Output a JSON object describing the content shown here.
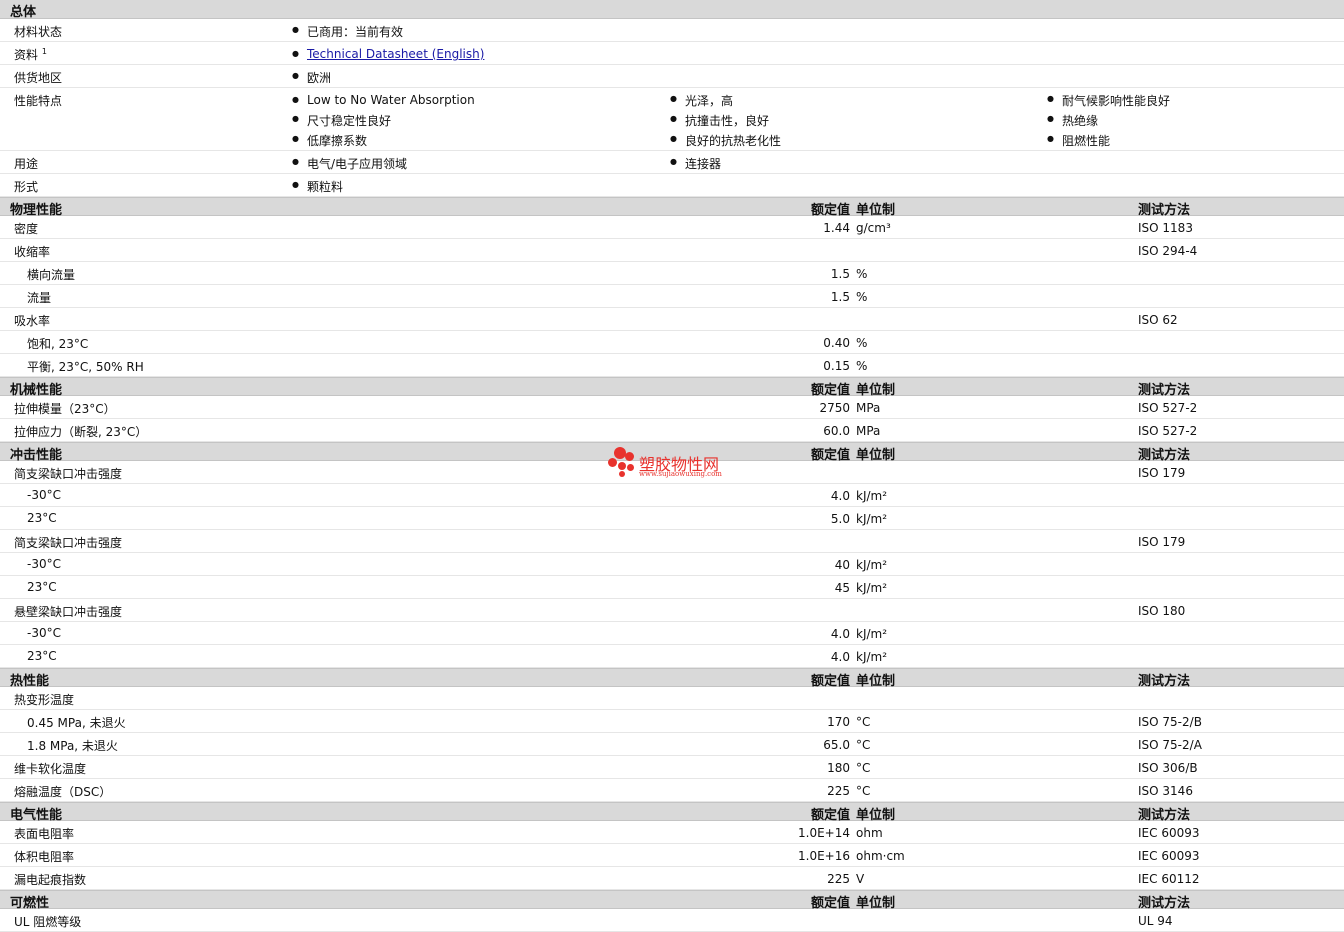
{
  "general": {
    "title": "总体",
    "status_label": "材料状态",
    "status_value": "已商用：当前有效",
    "doc_label": "资料",
    "doc_sup": "1",
    "doc_link": "Technical Datasheet (English)",
    "region_label": "供货地区",
    "region_value": "欧洲",
    "features_label": "性能特点",
    "features": [
      "Low to No Water Absorption",
      "光泽，高",
      "耐气候影响性能良好",
      "尺寸稳定性良好",
      "抗撞击性，良好",
      "热绝缘",
      "低摩擦系数",
      "良好的抗热老化性",
      "阻燃性能"
    ],
    "uses_label": "用途",
    "uses": [
      "电气/电子应用领域",
      "连接器"
    ],
    "form_label": "形式",
    "form_value": "颗粒料"
  },
  "headers": {
    "nominal": "额定值",
    "unit": "单位制",
    "test": "测试方法"
  },
  "physical": {
    "title": "物理性能",
    "rows": [
      {
        "label": "密度",
        "value": "1.44",
        "unit": "g/cm³",
        "test": "ISO 1183"
      },
      {
        "label": "收缩率",
        "value": "",
        "unit": "",
        "test": "ISO 294-4"
      },
      {
        "label": "横向流量",
        "value": "1.5",
        "unit": "%",
        "test": ""
      },
      {
        "label": "流量",
        "value": "1.5",
        "unit": "%",
        "test": ""
      },
      {
        "label": "吸水率",
        "value": "",
        "unit": "",
        "test": "ISO 62"
      },
      {
        "label": "饱和, 23°C",
        "value": "0.40",
        "unit": "%",
        "test": ""
      },
      {
        "label": "平衡, 23°C, 50% RH",
        "value": "0.15",
        "unit": "%",
        "test": ""
      }
    ]
  },
  "mechanical": {
    "title": "机械性能",
    "rows": [
      {
        "label": "拉伸模量（23°C）",
        "value": "2750",
        "unit": "MPa",
        "test": "ISO 527-2"
      },
      {
        "label": "拉伸应力（断裂, 23°C）",
        "value": "60.0",
        "unit": "MPa",
        "test": "ISO 527-2"
      }
    ]
  },
  "impact": {
    "title": "冲击性能",
    "rows": [
      {
        "label": "简支梁缺口冲击强度",
        "value": "",
        "unit": "",
        "test": "ISO 179"
      },
      {
        "label": "-30°C",
        "value": "4.0",
        "unit": "kJ/m²",
        "test": ""
      },
      {
        "label": "23°C",
        "value": "5.0",
        "unit": "kJ/m²",
        "test": ""
      },
      {
        "label": "简支梁缺口冲击强度",
        "value": "",
        "unit": "",
        "test": "ISO 179"
      },
      {
        "label": "-30°C",
        "value": "40",
        "unit": "kJ/m²",
        "test": ""
      },
      {
        "label": "23°C",
        "value": "45",
        "unit": "kJ/m²",
        "test": ""
      },
      {
        "label": "悬壁梁缺口冲击强度",
        "value": "",
        "unit": "",
        "test": "ISO 180"
      },
      {
        "label": "-30°C",
        "value": "4.0",
        "unit": "kJ/m²",
        "test": ""
      },
      {
        "label": "23°C",
        "value": "4.0",
        "unit": "kJ/m²",
        "test": ""
      }
    ]
  },
  "thermal": {
    "title": "热性能",
    "rows": [
      {
        "label": "热变形温度",
        "value": "",
        "unit": "",
        "test": ""
      },
      {
        "label": "0.45 MPa, 未退火",
        "value": "170",
        "unit": "°C",
        "test": "ISO 75-2/B"
      },
      {
        "label": "1.8 MPa, 未退火",
        "value": "65.0",
        "unit": "°C",
        "test": "ISO 75-2/A"
      },
      {
        "label": "维卡软化温度",
        "value": "180",
        "unit": "°C",
        "test": "ISO 306/B"
      },
      {
        "label": "熔融温度（DSC）",
        "value": "225",
        "unit": "°C",
        "test": "ISO 3146"
      }
    ]
  },
  "electrical": {
    "title": "电气性能",
    "rows": [
      {
        "label": "表面电阻率",
        "value": "1.0E+14",
        "unit": "ohm",
        "test": "IEC 60093"
      },
      {
        "label": "体积电阻率",
        "value": "1.0E+16",
        "unit": "ohm·cm",
        "test": "IEC 60093"
      },
      {
        "label": "漏电起痕指数",
        "value": "225",
        "unit": "V",
        "test": "IEC 60112"
      }
    ]
  },
  "flammability": {
    "title": "可燃性",
    "rows": [
      {
        "label": "UL 阻燃等级",
        "value": "",
        "unit": "",
        "test": "UL 94"
      }
    ]
  },
  "watermark": {
    "name": "塑胶物性网",
    "url": "www.sujiaowuxing.com",
    "color": "#e8322d"
  }
}
